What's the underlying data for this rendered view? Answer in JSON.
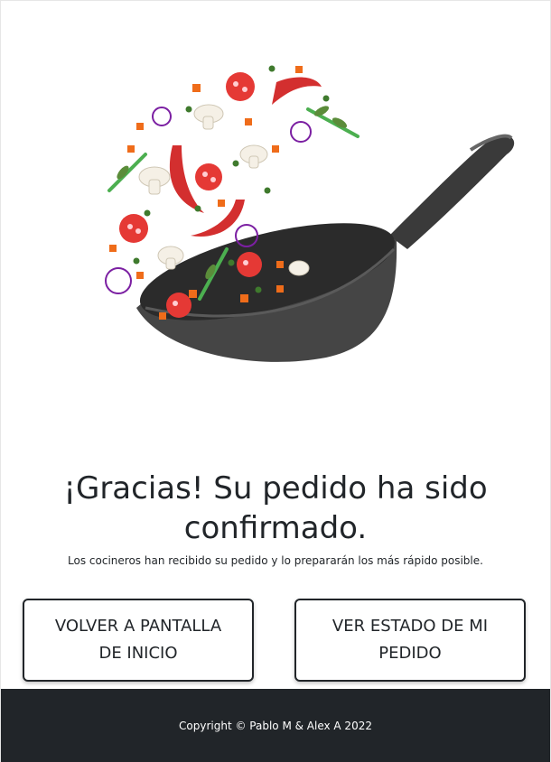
{
  "hero": {
    "image": "wok-with-flying-vegetables-illustration"
  },
  "confirmation": {
    "title": "¡Gracias! Su pedido ha sido confirmado.",
    "subtitle": "Los cocineros han recibido su pedido y lo prepararán los más rápido posible."
  },
  "actions": {
    "home_label": "VOLVER A PANTALLA DE INICIO",
    "status_label": "VER ESTADO DE MI PEDIDO"
  },
  "footer": {
    "copyright": "Copyright © Pablo M & Alex A 2022"
  },
  "colors": {
    "text": "#212529",
    "footer_bg": "#212529",
    "background": "#ffffff"
  }
}
